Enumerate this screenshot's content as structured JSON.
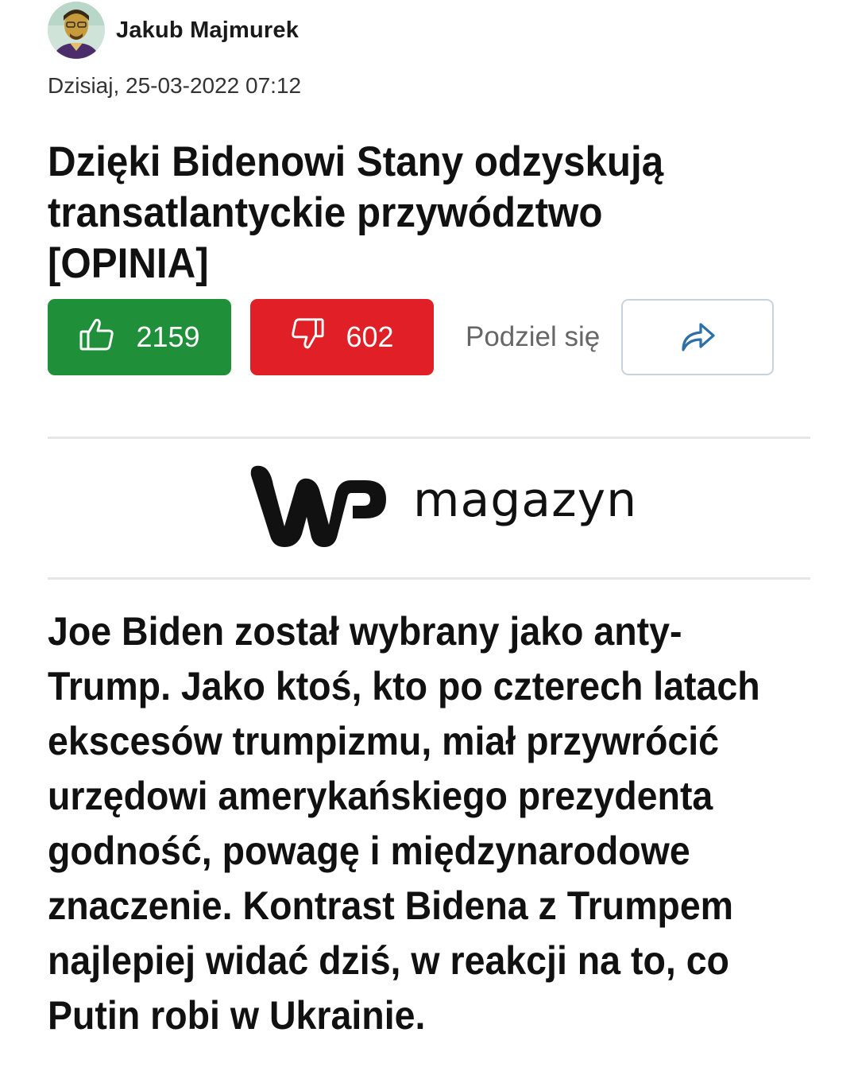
{
  "author": {
    "name": "Jakub Majmurek",
    "avatar_icon": "author-avatar"
  },
  "date": "Dzisiaj, 25-03-2022 07:12",
  "title": "Dzięki Bidenowi Stany odzyskują transatlantyckie przywództwo [OPINIA]",
  "reactions": {
    "like_icon": "thumbs-up-icon",
    "like_count": "2159",
    "like_color": "#1f8f3a",
    "dislike_icon": "thumbs-down-icon",
    "dislike_count": "602",
    "dislike_color": "#e01f26",
    "share_label": "Podziel się",
    "share_icon": "share-arrow-icon"
  },
  "brand": {
    "logo_icon": "wp-logo",
    "name": "magazyn"
  },
  "lead": "Joe Biden został wybrany jako anty-Trump. Jako ktoś, kto po czterech latach ekscesów trumpizmu, miał przywrócić urzędowi amerykańskiego prezydenta godność, powagę i międzynarodowe znaczenie. Kontrast Bidena z Trumpem najlepiej widać dziś, w reakcji na to, co Putin robi w Ukrainie."
}
